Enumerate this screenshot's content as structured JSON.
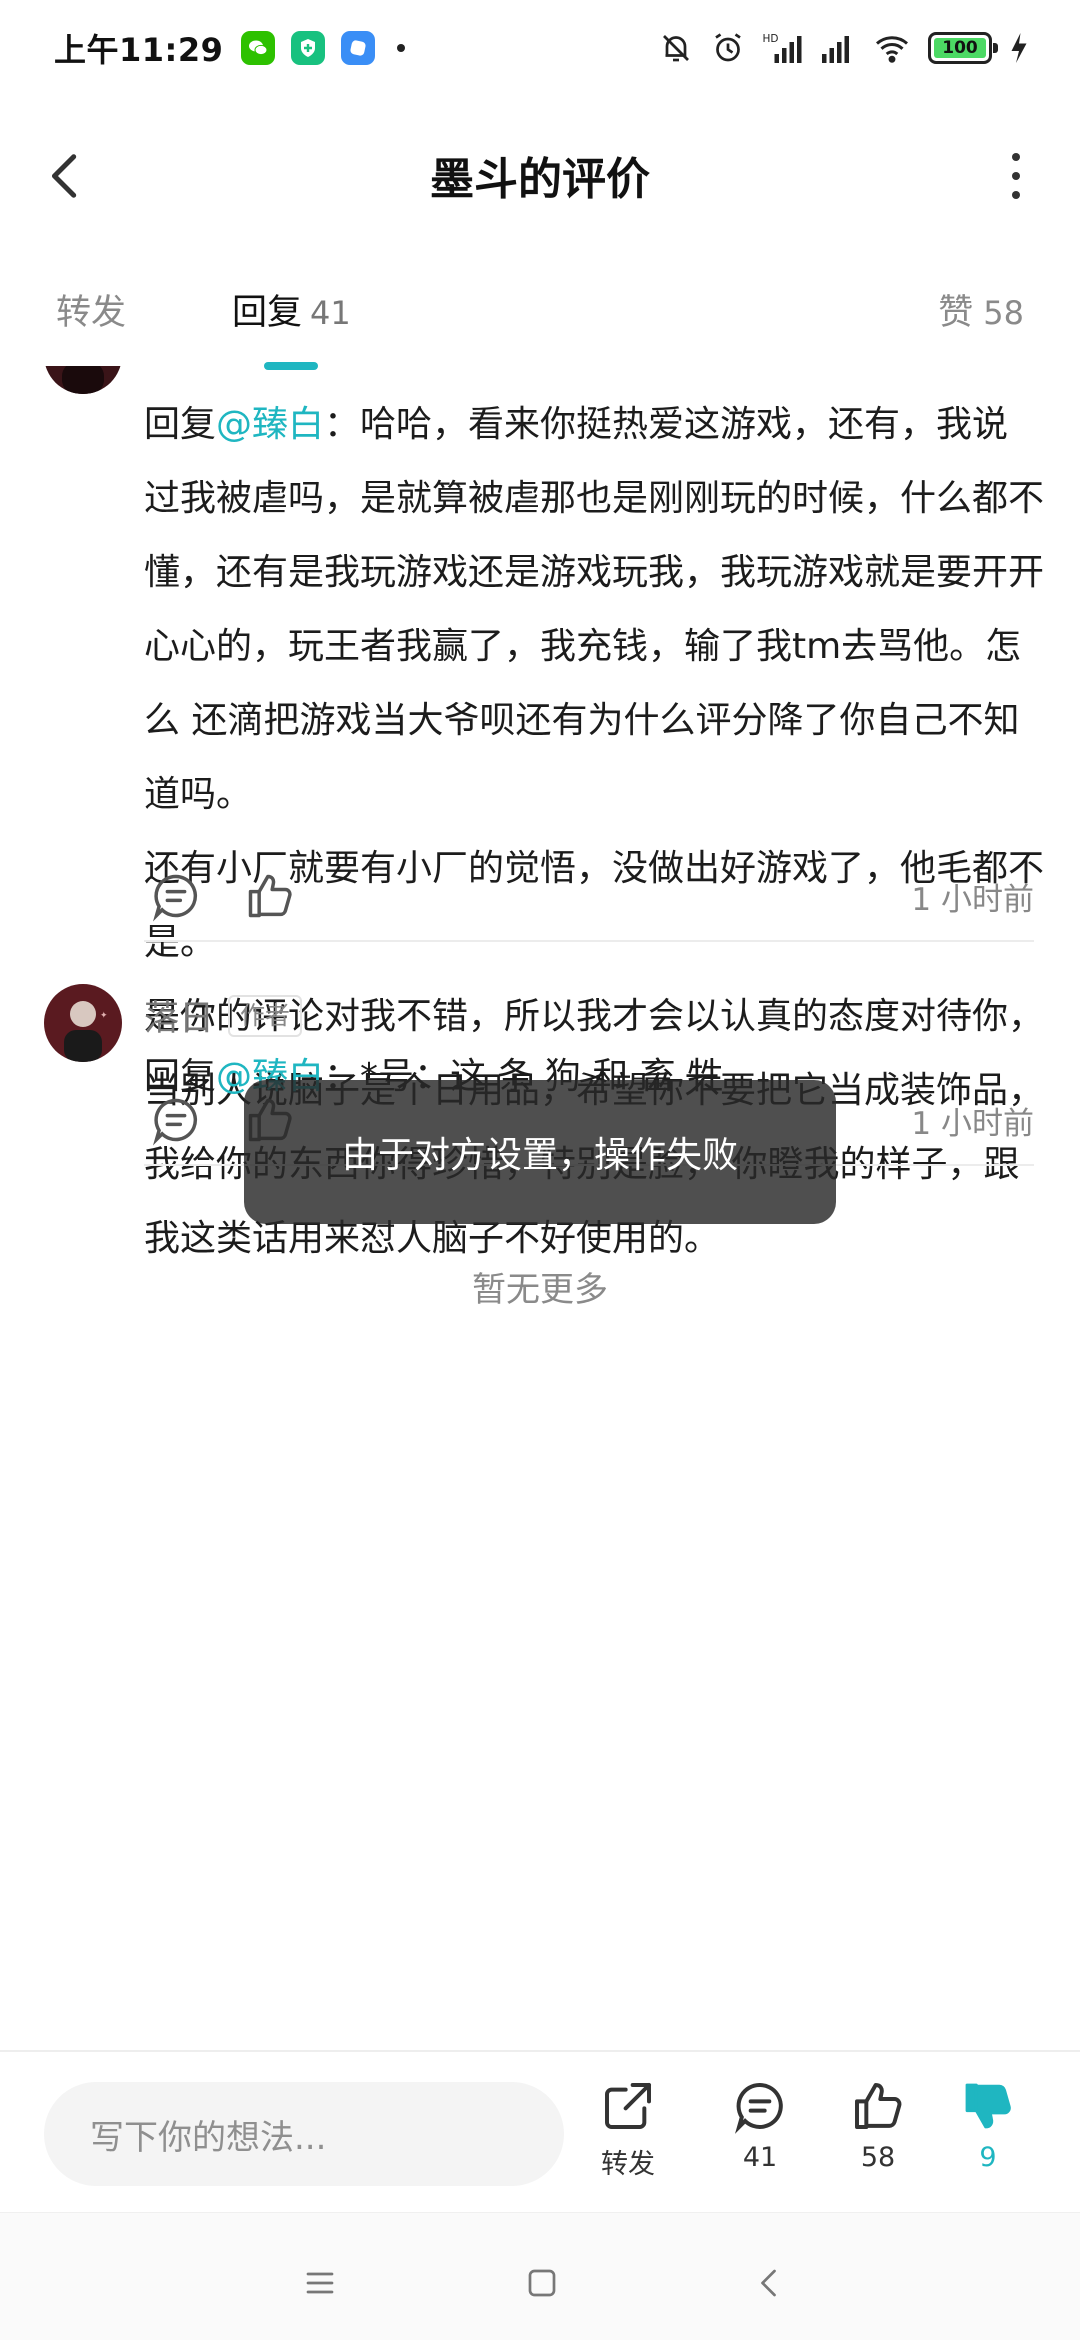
{
  "status_bar": {
    "time": "上午11:29",
    "battery": "100"
  },
  "header": {
    "title": "墨斗的评价"
  },
  "tabs": {
    "repost_label": "转发",
    "reply_label": "回复",
    "reply_count": "41",
    "like_label": "赞",
    "like_count": "58"
  },
  "comment1": {
    "prefix": "回复",
    "mention": "@臻白",
    "paragraph1": "：哈哈，看来你挺热爱这游戏，还有，我说过我被虐吗，是就算被虐那也是刚刚玩的时候，什么都不懂，还有是我玩游戏还是游戏玩我，我玩游戏就是要开开心心的，玩王者我赢了，我充钱，输了我tm去骂他。怎么 还滴把游戏当大爷呗还有为什么评分降了你自己不知道吗。",
    "paragraph2": "还有小厂就要有小厂的觉悟，没做出好游戏了，他毛都不是。",
    "paragraph3": "是你的评论对我不错，所以我才会以认真的态度对待你，当别人说脑子是个日用品，希望你不要把它当成装饰品， 我给你的东西你得珍惜，特别是脸， 你瞪我的样子，跟我这类话用来怼人脑子不好使用的。",
    "time": "1 小时前"
  },
  "comment2": {
    "author": "落日",
    "badge": "作者",
    "prefix": "回复",
    "mention": "@臻白",
    "text": "：*号：这 条 狗 和 畜 牲",
    "time": "1 小时前"
  },
  "no_more": "暂无更多",
  "toast": "由于对方设置，操作失败",
  "bottom_bar": {
    "input_placeholder": "写下你的想法...",
    "repost_label": "转发",
    "reply_count": "41",
    "like_count": "58",
    "dislike_count": "9"
  },
  "colors": {
    "accent": "#1fb6c1",
    "battery": "#4cd964"
  }
}
